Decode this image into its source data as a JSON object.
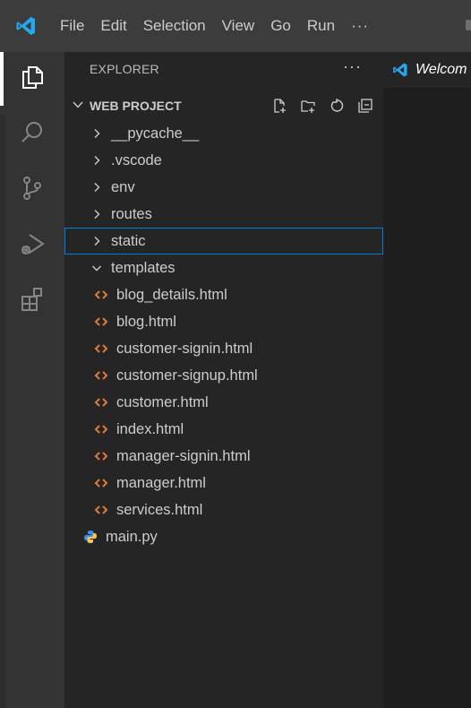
{
  "app": {
    "logo_icon": "vscode-logo-icon",
    "accent": "#0078d4"
  },
  "menu": {
    "items": [
      {
        "label": "File"
      },
      {
        "label": "Edit"
      },
      {
        "label": "Selection"
      },
      {
        "label": "View"
      },
      {
        "label": "Go"
      },
      {
        "label": "Run"
      }
    ],
    "more": "···"
  },
  "activity_bar": {
    "items": [
      {
        "name": "explorer",
        "icon": "files-icon",
        "active": true
      },
      {
        "name": "search",
        "icon": "search-icon"
      },
      {
        "name": "source-control",
        "icon": "source-control-icon"
      },
      {
        "name": "run-and-debug",
        "icon": "run-debug-icon"
      },
      {
        "name": "extensions",
        "icon": "extensions-icon"
      }
    ]
  },
  "explorer": {
    "title": "EXPLORER",
    "more": "···",
    "section": {
      "title": "WEB PROJECT",
      "actions": [
        "new-file-icon",
        "new-folder-icon",
        "refresh-icon",
        "collapse-all-icon"
      ]
    },
    "tree": [
      {
        "label": "__pycache__",
        "type": "folder",
        "expanded": false,
        "depth": 1
      },
      {
        "label": ".vscode",
        "type": "folder",
        "expanded": false,
        "depth": 1
      },
      {
        "label": "env",
        "type": "folder",
        "expanded": false,
        "depth": 1
      },
      {
        "label": "routes",
        "type": "folder",
        "expanded": false,
        "depth": 1
      },
      {
        "label": "static",
        "type": "folder",
        "expanded": false,
        "depth": 1,
        "focused": true
      },
      {
        "label": "templates",
        "type": "folder",
        "expanded": true,
        "depth": 1
      },
      {
        "label": "blog_details.html",
        "type": "html",
        "depth": 2
      },
      {
        "label": "blog.html",
        "type": "html",
        "depth": 2
      },
      {
        "label": "customer-signin.html",
        "type": "html",
        "depth": 2
      },
      {
        "label": "customer-signup.html",
        "type": "html",
        "depth": 2
      },
      {
        "label": "customer.html",
        "type": "html",
        "depth": 2
      },
      {
        "label": "index.html",
        "type": "html",
        "depth": 2
      },
      {
        "label": "manager-signin.html",
        "type": "html",
        "depth": 2
      },
      {
        "label": "manager.html",
        "type": "html",
        "depth": 2
      },
      {
        "label": "services.html",
        "type": "html",
        "depth": 2
      },
      {
        "label": "main.py",
        "type": "python",
        "depth": 1
      }
    ]
  },
  "editor": {
    "tab": {
      "label": "Welcom",
      "icon": "vscode-logo-icon"
    }
  },
  "colors": {
    "html_icon": "#e37933",
    "python_icon": "#3b8eea",
    "focus_border": "#007fd4"
  }
}
